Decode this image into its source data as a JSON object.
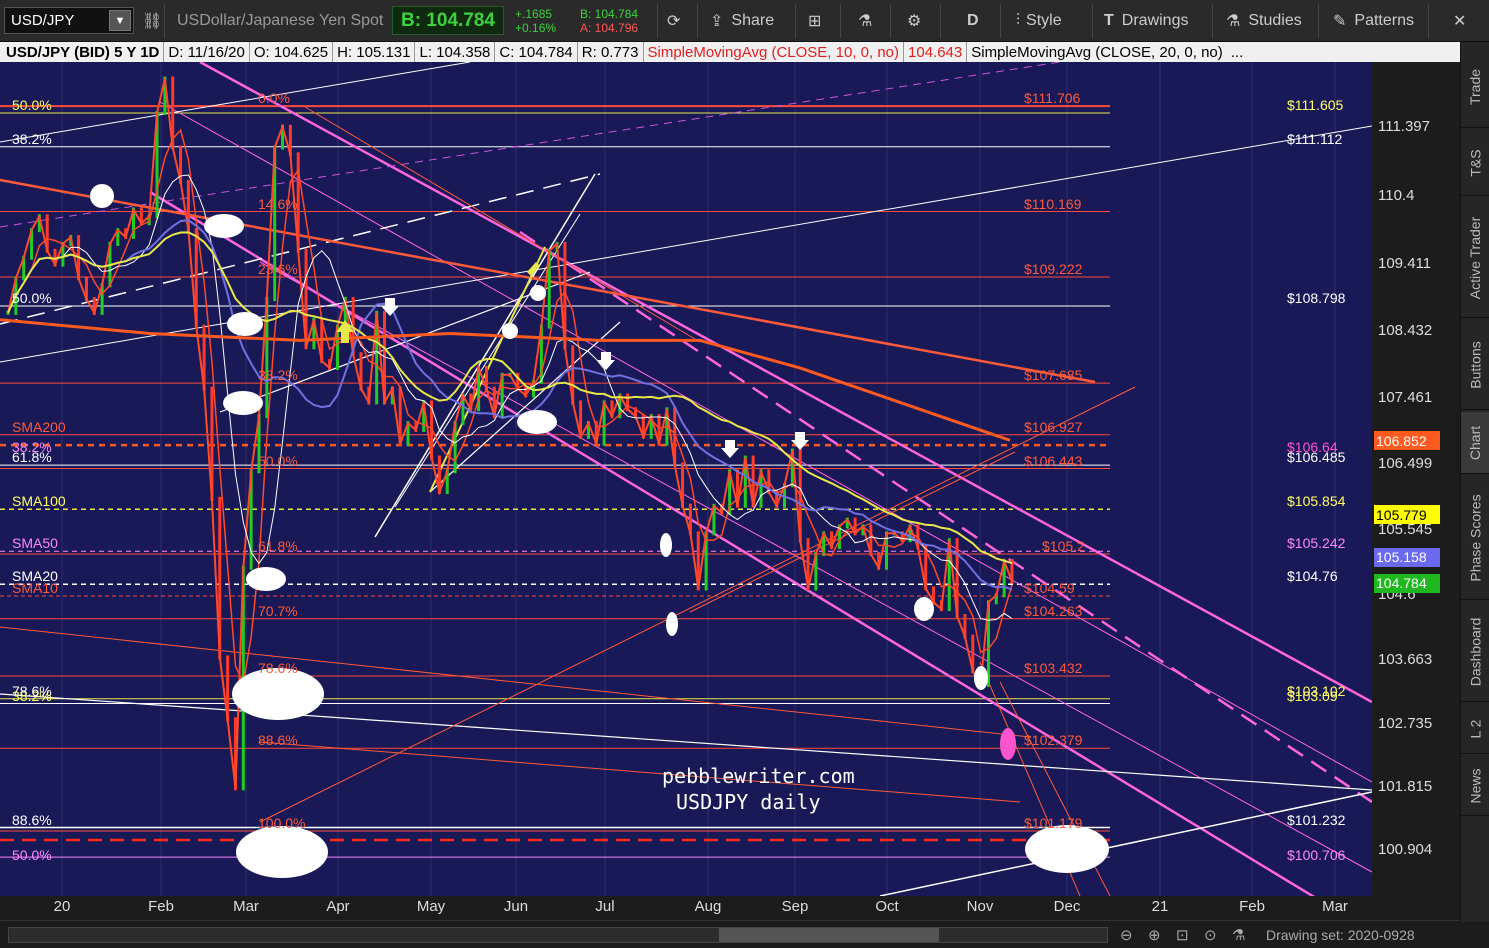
{
  "toolbar": {
    "symbol": "USD/JPY",
    "description": "USDollar/Japanese Yen Spot",
    "bid_label": "B: 104.784",
    "change": "+.1685",
    "change_pct": "+0.16%",
    "bid_small": "B: 104.784",
    "ask_small": "A: 104.796",
    "share": "Share",
    "period": "D",
    "style": "Style",
    "drawings": "Drawings",
    "studies": "Studies",
    "patterns": "Patterns"
  },
  "infobar": {
    "title": "USD/JPY (BID) 5 Y 1D",
    "date": "D: 11/16/20",
    "open": "O: 104.625",
    "high": "H: 105.131",
    "low": "L: 104.358",
    "close": "C: 104.784",
    "range": "R: 0.773",
    "sma10": "SimpleMovingAvg (CLOSE, 10, 0, no)",
    "sma10_val": "104.643",
    "sma20": "SimpleMovingAvg (CLOSE, 20, 0, no)",
    "more": "..."
  },
  "yaxis": {
    "ticks": [
      "111.397",
      "110.4",
      "109.411",
      "108.432",
      "107.461",
      "106.499",
      "105.545",
      "104.6",
      "103.663",
      "102.735",
      "101.815",
      "100.904"
    ],
    "badges": [
      {
        "text": "106.852",
        "color": "#ff5a1f",
        "value": 106.852
      },
      {
        "text": "105.779",
        "color": "#ffff00",
        "value": 105.779
      },
      {
        "text": "105.158",
        "color": "#6a6af0",
        "value": 105.158
      },
      {
        "text": "104.784",
        "color": "#1fb81f",
        "value": 104.784
      }
    ]
  },
  "xaxis": {
    "ticks": [
      "20",
      "Feb",
      "Mar",
      "Apr",
      "May",
      "Jun",
      "Jul",
      "Aug",
      "Sep",
      "Oct",
      "Nov",
      "Dec",
      "21",
      "Feb",
      "Mar"
    ]
  },
  "levels_right": [
    {
      "text": "$111.706",
      "color": "#ff5a3a",
      "value": 111.7
    },
    {
      "text": "$111.605",
      "color": "#ffff66",
      "value": 111.6
    },
    {
      "text": "$111.112",
      "color": "#ffffff",
      "value": 111.11
    },
    {
      "text": "$110.169",
      "color": "#ff5a3a",
      "value": 110.17
    },
    {
      "text": "$109.222",
      "color": "#ff5a3a",
      "value": 109.22
    },
    {
      "text": "$108.798",
      "color": "#ffffff",
      "value": 108.8
    },
    {
      "text": "$107.685",
      "color": "#ff5a3a",
      "value": 107.68
    },
    {
      "text": "$106.927",
      "color": "#ff5a3a",
      "value": 106.93
    },
    {
      "text": "$106.64",
      "color": "#ff55cc",
      "value": 106.64
    },
    {
      "text": "$106.443",
      "color": "#ff5a3a",
      "value": 106.44
    },
    {
      "text": "$106.485",
      "color": "#ffffff",
      "value": 106.49
    },
    {
      "text": "$105.854",
      "color": "#ffff66",
      "value": 105.85
    },
    {
      "text": "$105.2",
      "color": "#ff5a3a",
      "value": 105.2
    },
    {
      "text": "$105.242",
      "color": "#ff88ff",
      "value": 105.24
    },
    {
      "text": "$104.76",
      "color": "#ffffff",
      "value": 104.76
    },
    {
      "text": "$104.59",
      "color": "#ff5a3a",
      "value": 104.59
    },
    {
      "text": "$104.263",
      "color": "#ff5a3a",
      "value": 104.26
    },
    {
      "text": "$103.432",
      "color": "#ff5a3a",
      "value": 103.43
    },
    {
      "text": "$103.102",
      "color": "#ffff66",
      "value": 103.1
    },
    {
      "text": "$103.09",
      "color": "#ffff66",
      "value": 103.03
    },
    {
      "text": "$102.379",
      "color": "#ff5a3a",
      "value": 102.38
    },
    {
      "text": "$101.232",
      "color": "#ffffff",
      "value": 101.23
    },
    {
      "text": "$101.179",
      "color": "#ff5a3a",
      "value": 101.18
    },
    {
      "text": "$100.706",
      "color": "#ff88ff",
      "value": 100.71
    }
  ],
  "levels_left": [
    {
      "text": "50.0%",
      "color": "#ffff66",
      "value": 111.6
    },
    {
      "text": "38.2%",
      "color": "#ffffff",
      "value": 111.11
    },
    {
      "text": "50.0%",
      "color": "#ffffff",
      "value": 108.8
    },
    {
      "text": "SMA200",
      "color": "#ff5a3a",
      "value": 106.93
    },
    {
      "text": "38.2%",
      "color": "#ff88ff",
      "value": 106.64
    },
    {
      "text": "61.8%",
      "color": "#ffffff",
      "value": 106.49
    },
    {
      "text": "SMA100",
      "color": "#ffff66",
      "value": 105.85
    },
    {
      "text": "SMA50",
      "color": "#ff88ff",
      "value": 105.24
    },
    {
      "text": "SMA20",
      "color": "#ffffff",
      "value": 104.76
    },
    {
      "text": "SMA10",
      "color": "#ff5a3a",
      "value": 104.59
    },
    {
      "text": "78.6%",
      "color": "#ffffff",
      "value": 103.1
    },
    {
      "text": "38.2%",
      "color": "#ffff66",
      "value": 103.03
    },
    {
      "text": "88.6%",
      "color": "#ffffff",
      "value": 101.23
    },
    {
      "text": "50.0%",
      "color": "#ff88ff",
      "value": 100.71
    }
  ],
  "fib_mid": [
    {
      "text": "0.0%",
      "value": 111.7
    },
    {
      "text": "14.6%",
      "value": 110.17
    },
    {
      "text": "23.6%",
      "value": 109.22
    },
    {
      "text": "38.2%",
      "value": 107.68
    },
    {
      "text": "50.0%",
      "value": 106.44
    },
    {
      "text": "61.8%",
      "value": 105.2
    },
    {
      "text": "70.7%",
      "value": 104.26
    },
    {
      "text": "78.6%",
      "value": 103.43
    },
    {
      "text": "88.6%",
      "value": 102.38
    },
    {
      "text": "100.0%",
      "value": 101.18
    }
  ],
  "watermark": {
    "line1": "pebblewriter.com",
    "line2": "USDJPY daily"
  },
  "side_tabs": [
    "Trade",
    "T&S",
    "Active Trader",
    "Buttons",
    "Chart",
    "Phase Scores",
    "Dashboard",
    "L 2",
    "News"
  ],
  "status": {
    "drawing_set": "Drawing set: 2020-0928"
  },
  "colors": {
    "chart_bg": "#191957",
    "sma10": "#ff4a2a",
    "sma200": "#ff5a1f",
    "sma100": "#e8e84a",
    "sma50": "#7070e0",
    "sma20": "#ffffff",
    "fan_pink": "#ff66dd"
  }
}
